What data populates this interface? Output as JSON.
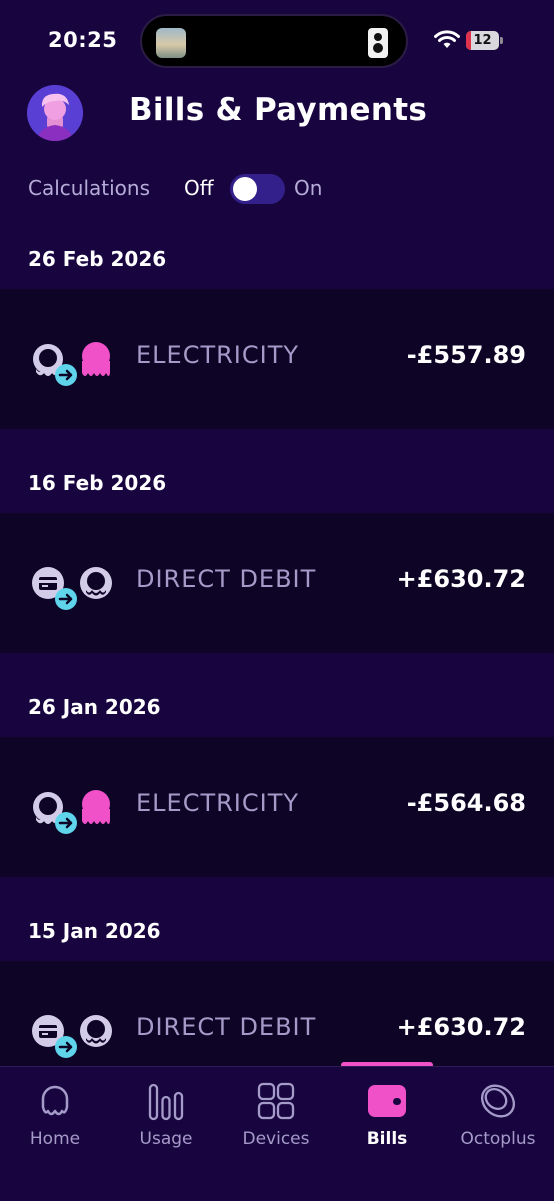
{
  "status_bar": {
    "time": "20:25",
    "battery": "12",
    "icons": [
      "media-thumbnail-icon",
      "speaker-icon",
      "wifi-icon",
      "battery-icon"
    ]
  },
  "header": {
    "title": "Bills & Payments",
    "avatar_icon": "avatar-icon"
  },
  "calculations": {
    "label": "Calculations",
    "off_label": "Off",
    "on_label": "On",
    "enabled": false
  },
  "transactions": [
    {
      "date": "26 Feb 2026",
      "label": "ELECTRICITY",
      "amount": "-£557.89",
      "kind": "electricity"
    },
    {
      "date": "16 Feb 2026",
      "label": "DIRECT DEBIT",
      "amount": "+£630.72",
      "kind": "direct-debit"
    },
    {
      "date": "26 Jan 2026",
      "label": "ELECTRICITY",
      "amount": "-£564.68",
      "kind": "electricity"
    },
    {
      "date": "15 Jan 2026",
      "label": "DIRECT DEBIT",
      "amount": "+£630.72",
      "kind": "direct-debit"
    }
  ],
  "nav": {
    "items": [
      {
        "label": "Home",
        "icon": "octopus-icon",
        "active": false
      },
      {
        "label": "Usage",
        "icon": "usage-bars-icon",
        "active": false
      },
      {
        "label": "Devices",
        "icon": "devices-grid-icon",
        "active": false
      },
      {
        "label": "Bills",
        "icon": "wallet-icon",
        "active": true
      },
      {
        "label": "Octoplus",
        "icon": "octoplus-coin-icon",
        "active": false
      }
    ]
  },
  "colors": {
    "background": "#180540",
    "row_background": "#0d0426",
    "accent_pink": "#f050c8",
    "accent_cyan": "#5fd4ea",
    "muted_text": "#a49bc8"
  }
}
